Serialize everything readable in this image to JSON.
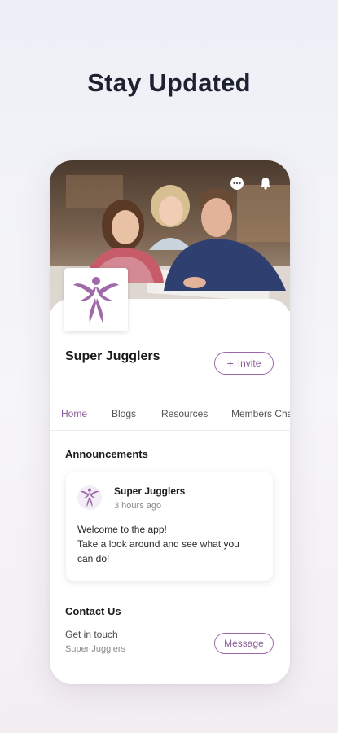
{
  "headline": "Stay Updated",
  "header": {
    "icons": [
      "chat-icon",
      "bell-icon"
    ]
  },
  "group": {
    "name": "Super Jugglers",
    "invite_label": "Invite"
  },
  "tabs": [
    {
      "label": "Home",
      "active": true
    },
    {
      "label": "Blogs",
      "active": false
    },
    {
      "label": "Resources",
      "active": false
    },
    {
      "label": "Members Cha",
      "active": false
    }
  ],
  "announcements": {
    "title": "Announcements",
    "post": {
      "author": "Super Jugglers",
      "time": "3 hours ago",
      "lines": [
        "Welcome to the app!",
        "Take a look around and see what you",
        "can do!"
      ]
    }
  },
  "contact": {
    "title": "Contact Us",
    "subtitle": "Get in touch",
    "name": "Super Jugglers",
    "message_label": "Message"
  },
  "colors": {
    "accent": "#8a5c98",
    "logo": "#a06aaa"
  }
}
